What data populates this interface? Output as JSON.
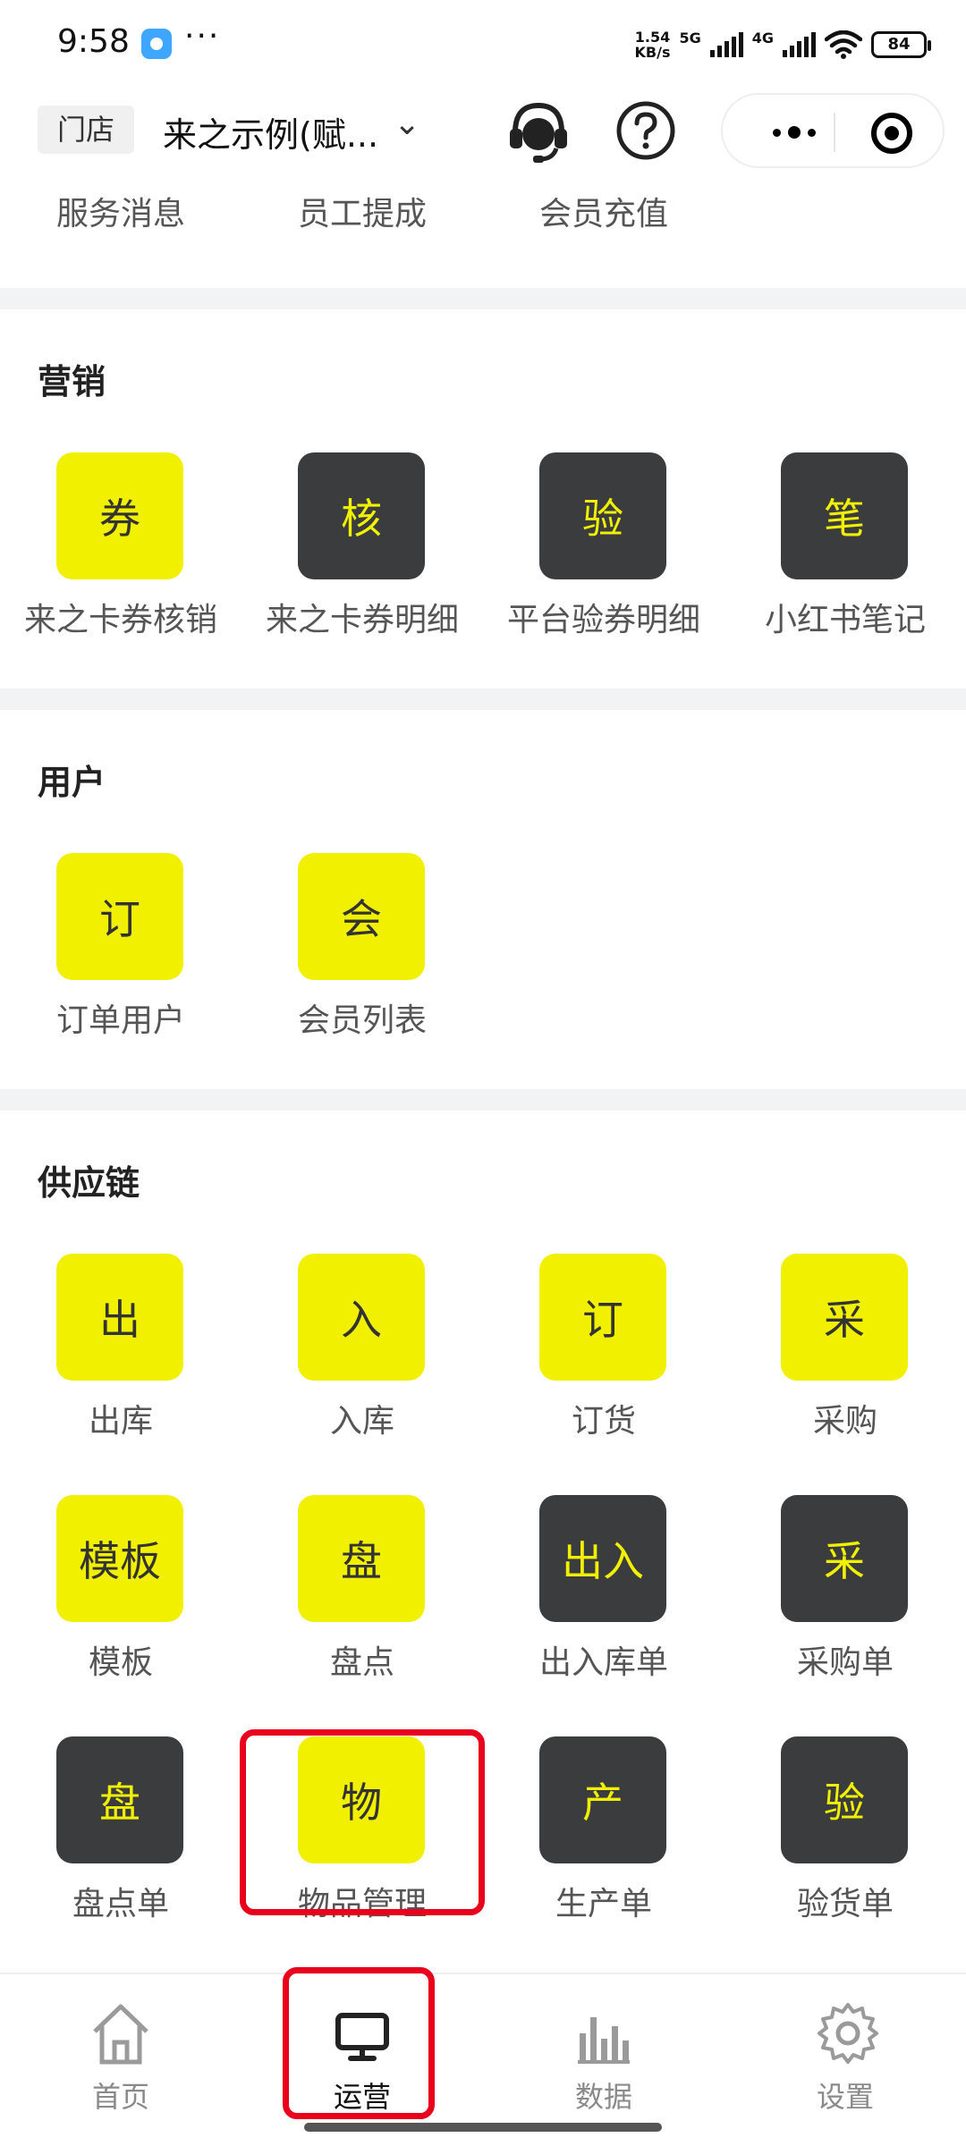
{
  "status_bar": {
    "time": "9:58",
    "dots": "···",
    "speed_top": "1.54",
    "speed_unit": "KB/s",
    "net1": "5G",
    "net2": "4G",
    "battery": "84"
  },
  "header": {
    "store_tag": "门店",
    "store_name": "来之示例(赋...",
    "chevron": "⌄"
  },
  "top_links": [
    "服务消息",
    "员工提成",
    "会员充值"
  ],
  "sections": {
    "marketing": {
      "title": "营销",
      "items": [
        {
          "icon_text": "券",
          "label": "来之卡券核销",
          "style": "yellow"
        },
        {
          "icon_text": "核",
          "label": "来之卡券明细",
          "style": "dark"
        },
        {
          "icon_text": "验",
          "label": "平台验券明细",
          "style": "dark"
        },
        {
          "icon_text": "笔",
          "label": "小红书笔记",
          "style": "dark"
        }
      ]
    },
    "users": {
      "title": "用户",
      "items": [
        {
          "icon_text": "订",
          "label": "订单用户",
          "style": "yellow"
        },
        {
          "icon_text": "会",
          "label": "会员列表",
          "style": "yellow"
        }
      ]
    },
    "supply": {
      "title": "供应链",
      "items": [
        {
          "icon_text": "出",
          "label": "出库",
          "style": "yellow"
        },
        {
          "icon_text": "入",
          "label": "入库",
          "style": "yellow"
        },
        {
          "icon_text": "订",
          "label": "订货",
          "style": "yellow"
        },
        {
          "icon_text": "采",
          "label": "采购",
          "style": "yellow"
        },
        {
          "icon_text": "模板",
          "label": "模板",
          "style": "yellow"
        },
        {
          "icon_text": "盘",
          "label": "盘点",
          "style": "yellow"
        },
        {
          "icon_text": "出入",
          "label": "出入库单",
          "style": "dark"
        },
        {
          "icon_text": "采",
          "label": "采购单",
          "style": "dark"
        },
        {
          "icon_text": "盘",
          "label": "盘点单",
          "style": "dark"
        },
        {
          "icon_text": "物",
          "label": "物品管理",
          "style": "yellow"
        },
        {
          "icon_text": "产",
          "label": "生产单",
          "style": "dark"
        },
        {
          "icon_text": "验",
          "label": "验货单",
          "style": "dark"
        }
      ]
    }
  },
  "tabbar": {
    "tabs": [
      {
        "label": "首页",
        "icon": "home-icon"
      },
      {
        "label": "运营",
        "icon": "monitor-icon"
      },
      {
        "label": "数据",
        "icon": "bar-chart-icon"
      },
      {
        "label": "设置",
        "icon": "gear-icon"
      }
    ],
    "active_index": 1
  },
  "colors": {
    "accent_yellow": "#f0f000",
    "dark_tile": "#3a3c3e",
    "highlight_red": "#e8001c"
  }
}
